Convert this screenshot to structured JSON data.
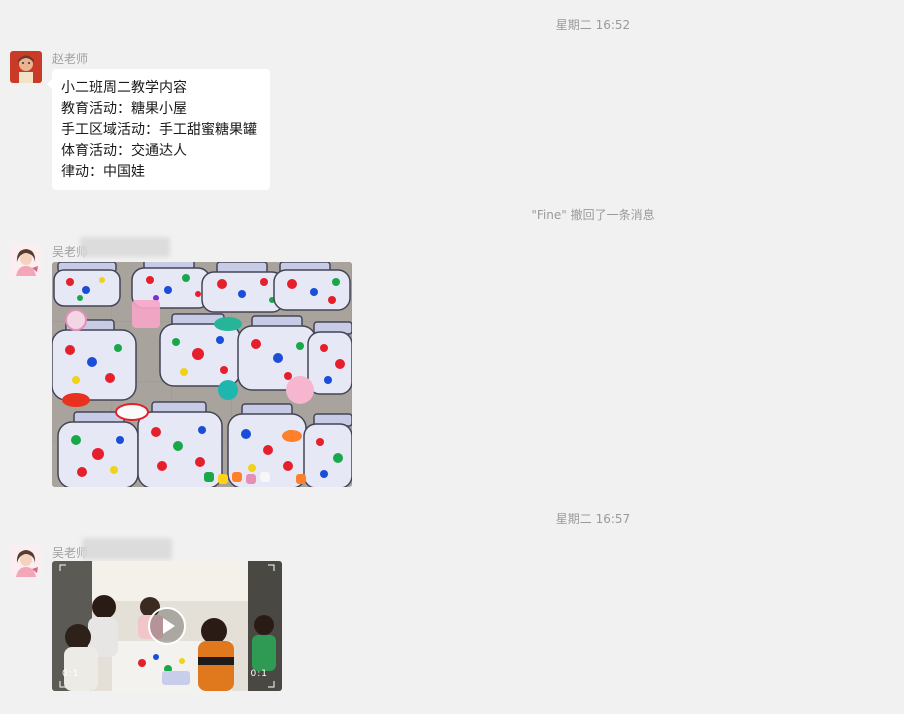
{
  "conversation": [
    {
      "type": "timestamp",
      "text": "星期二 16:52"
    },
    {
      "type": "text_message",
      "sender": "赵老师",
      "lines": [
        "小二班周二教学内容",
        "教育活动：糖果小屋",
        "手工区域活动：手工甜蜜糖果罐",
        "体育活动：交通达人",
        "律动：中国娃"
      ]
    },
    {
      "type": "system",
      "text": "\"Fine\" 撤回了一条消息"
    },
    {
      "type": "image_message",
      "sender": "吴老师"
    },
    {
      "type": "timestamp",
      "text": "星期二 16:57"
    },
    {
      "type": "video_message",
      "sender": "吴老师",
      "duration_left": "0:1",
      "duration_right": "0:1"
    }
  ]
}
